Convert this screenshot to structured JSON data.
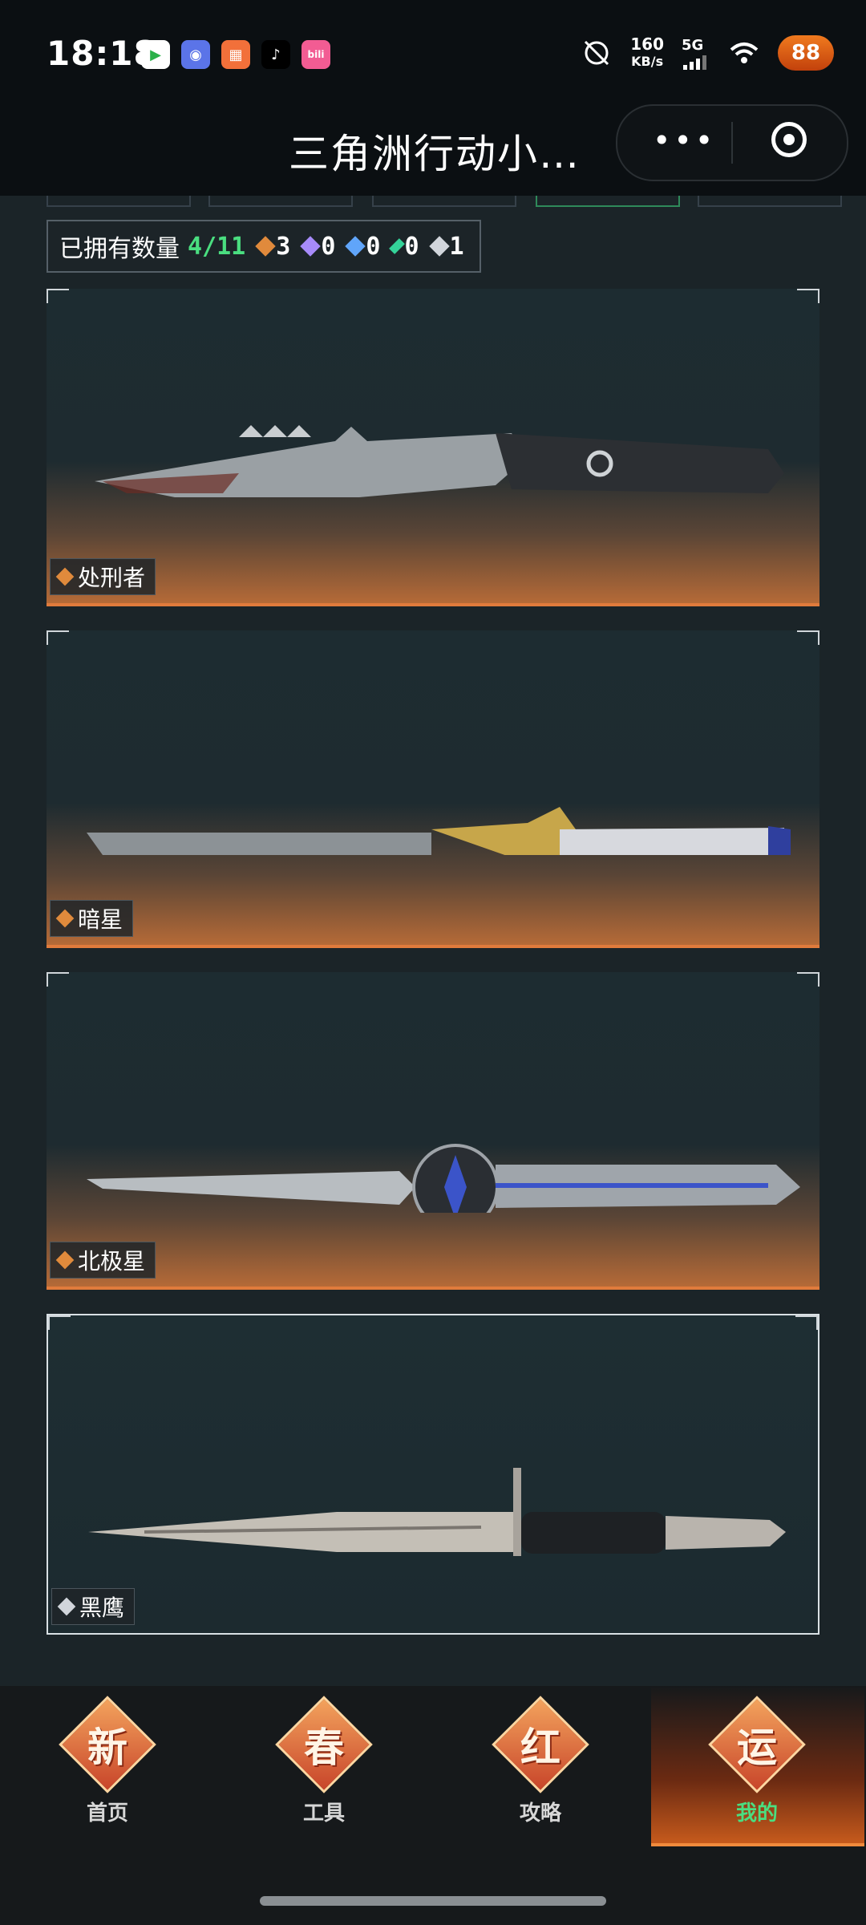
{
  "status_bar": {
    "time": "18:18",
    "network_speed_value": "160",
    "network_speed_unit": "KB/s",
    "signal_type": "5G",
    "battery_badge": "88"
  },
  "title_bar": {
    "title": "三角洲行动小…"
  },
  "summary": {
    "owned_label": "已拥有数量",
    "owned_value": "4/11",
    "rarity_counts": [
      {
        "icon": "gold-diamond-icon",
        "count": "3",
        "color": "#e08a3c"
      },
      {
        "icon": "purple-diamond-icon",
        "count": "0",
        "color": "#a78bfa"
      },
      {
        "icon": "blue-diamond-icon",
        "count": "0",
        "color": "#60a5fa"
      },
      {
        "icon": "green-diamond-icon",
        "count": "0",
        "color": "#34d399"
      },
      {
        "icon": "white-diamond-icon",
        "count": "1",
        "color": "#d1d5db"
      }
    ]
  },
  "knives": [
    {
      "name": "处刑者",
      "rarity_color": "#e08a3c"
    },
    {
      "name": "暗星",
      "rarity_color": "#e08a3c"
    },
    {
      "name": "北极星",
      "rarity_color": "#e08a3c"
    },
    {
      "name": "黑鹰",
      "rarity_color": "#d1d5db"
    }
  ],
  "bottom_nav": [
    {
      "emblem": "新",
      "label": "首页",
      "active": false
    },
    {
      "emblem": "春",
      "label": "工具",
      "active": false
    },
    {
      "emblem": "红",
      "label": "攻略",
      "active": false
    },
    {
      "emblem": "运",
      "label": "我的",
      "active": true
    }
  ]
}
